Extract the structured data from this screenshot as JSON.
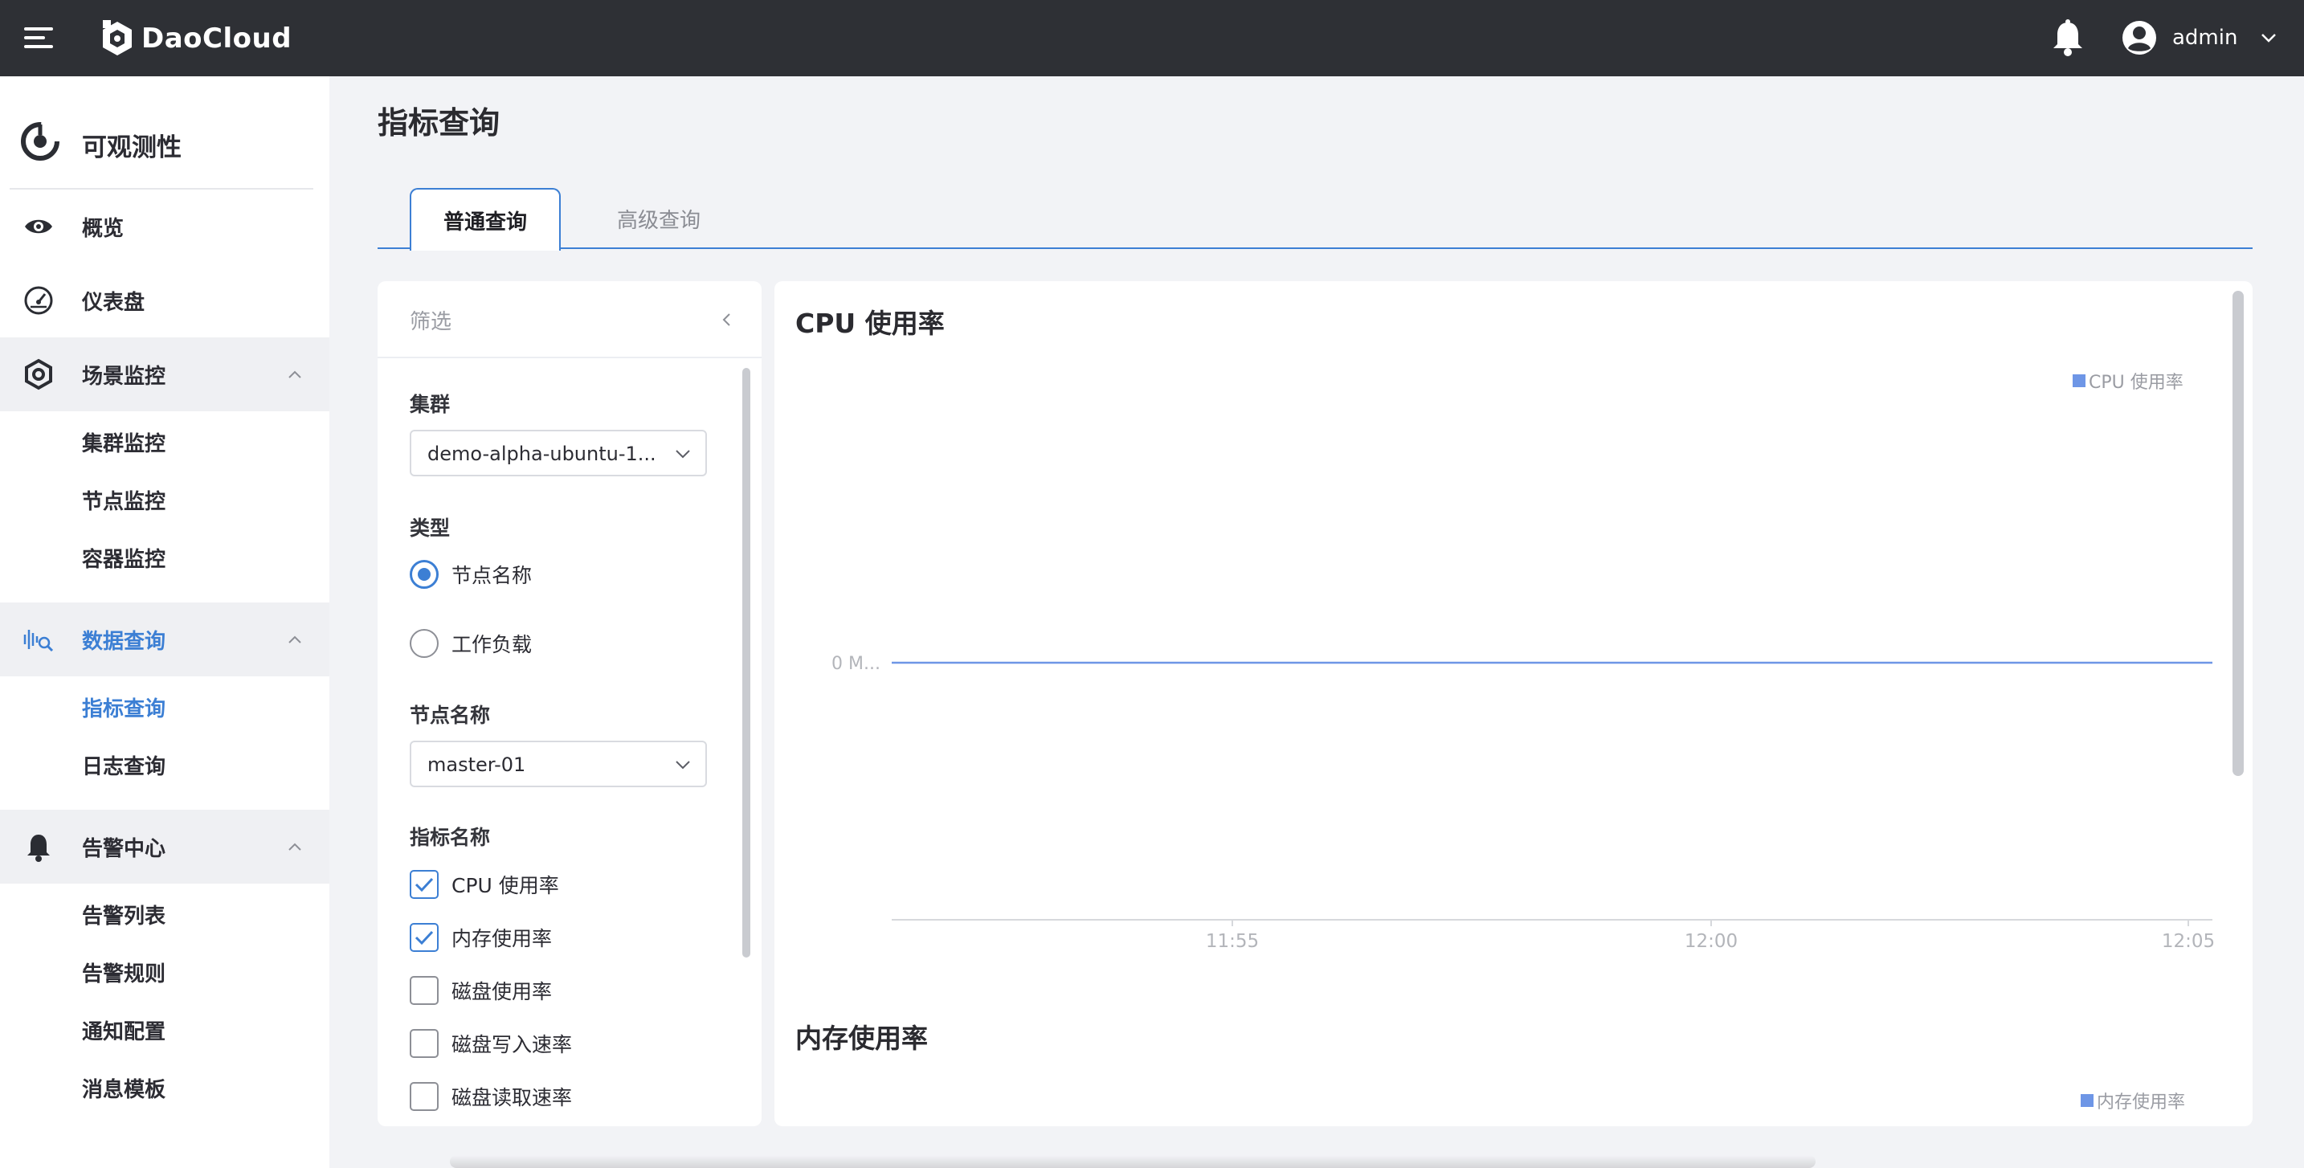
{
  "topbar": {
    "brand": "DaoCloud",
    "user_name": "admin"
  },
  "sidebar": {
    "title": "可观测性",
    "items": [
      {
        "label": "概览",
        "icon": "eye-icon"
      },
      {
        "label": "仪表盘",
        "icon": "gauge-icon"
      },
      {
        "label": "场景监控",
        "icon": "hexagon-icon",
        "children": [
          "集群监控",
          "节点监控",
          "容器监控"
        ]
      },
      {
        "label": "数据查询",
        "icon": "waveform-search-icon",
        "children": [
          "指标查询",
          "日志查询"
        ],
        "active_child": "指标查询"
      },
      {
        "label": "告警中心",
        "icon": "bell-icon",
        "children": [
          "告警列表",
          "告警规则",
          "通知配置",
          "消息模板"
        ]
      }
    ]
  },
  "page": {
    "title": "指标查询",
    "tabs": [
      "普通查询",
      "高级查询"
    ],
    "active_tab": "普通查询"
  },
  "filter": {
    "title": "筛选",
    "cluster_label": "集群",
    "cluster_value": "demo-alpha-ubuntu-1...",
    "type_label": "类型",
    "type_options": [
      {
        "label": "节点名称",
        "selected": true
      },
      {
        "label": "工作负载",
        "selected": false
      }
    ],
    "node_label": "节点名称",
    "node_value": "master-01",
    "metric_label": "指标名称",
    "metrics": [
      {
        "label": "CPU 使用率",
        "checked": true
      },
      {
        "label": "内存使用率",
        "checked": true
      },
      {
        "label": "磁盘使用率",
        "checked": false
      },
      {
        "label": "磁盘写入速率",
        "checked": false
      },
      {
        "label": "磁盘读取速率",
        "checked": false
      }
    ]
  },
  "colors": {
    "accent": "#3c7fd4",
    "series": "#6e96e6",
    "topbar": "#2e3035"
  },
  "chart_data": [
    {
      "type": "line",
      "title": "CPU 使用率",
      "x": [
        "11:55",
        "12:00",
        "12:05"
      ],
      "y_tick": "0 M...",
      "series": [
        {
          "name": "CPU 使用率",
          "values": [
            0,
            0,
            0
          ]
        }
      ],
      "legend": "top-right",
      "grid": false
    },
    {
      "type": "line",
      "title": "内存使用率",
      "series": [
        {
          "name": "内存使用率"
        }
      ],
      "legend": "top-right"
    }
  ]
}
